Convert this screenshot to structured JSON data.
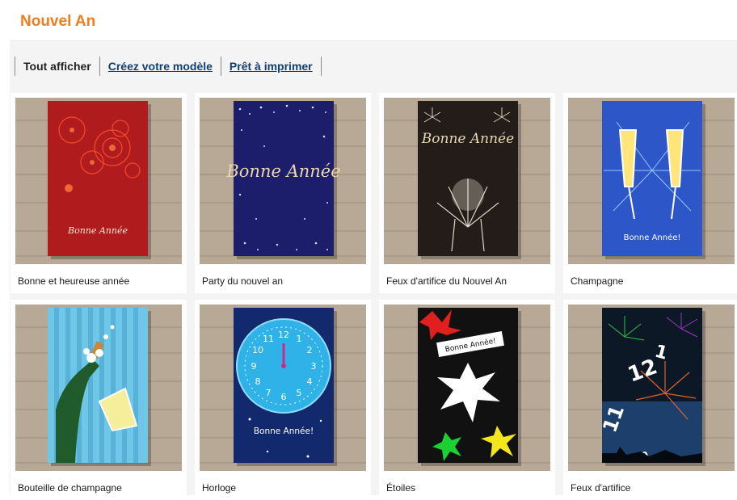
{
  "page": {
    "title": "Nouvel An"
  },
  "filters": [
    {
      "label": "Tout afficher",
      "active": true
    },
    {
      "label": "Créez votre modèle",
      "active": false
    },
    {
      "label": "Prêt à imprimer",
      "active": false
    }
  ],
  "cards": [
    {
      "caption": "Bonne et heureuse année",
      "card_text": "Bonne Année"
    },
    {
      "caption": "Party du nouvel an",
      "card_text": "Bonne Année"
    },
    {
      "caption": "Feux d'artifice du Nouvel An",
      "card_text": "Bonne Année"
    },
    {
      "caption": "Champagne",
      "card_text": "Bonne Année!"
    },
    {
      "caption": "Bouteille de champagne",
      "card_text": ""
    },
    {
      "caption": "Horloge",
      "card_text": "Bonne Année!",
      "clock_numbers": [
        "12",
        "1",
        "2",
        "3",
        "4",
        "5",
        "6",
        "7",
        "8",
        "9",
        "10",
        "11"
      ]
    },
    {
      "caption": "Étoiles",
      "card_text": "Bonne Année!"
    },
    {
      "caption": "Feux d'artifice",
      "card_text": ""
    }
  ],
  "colors": {
    "title": "#f07d1c",
    "link": "#0f3f73",
    "wood": "#b9ab96"
  }
}
